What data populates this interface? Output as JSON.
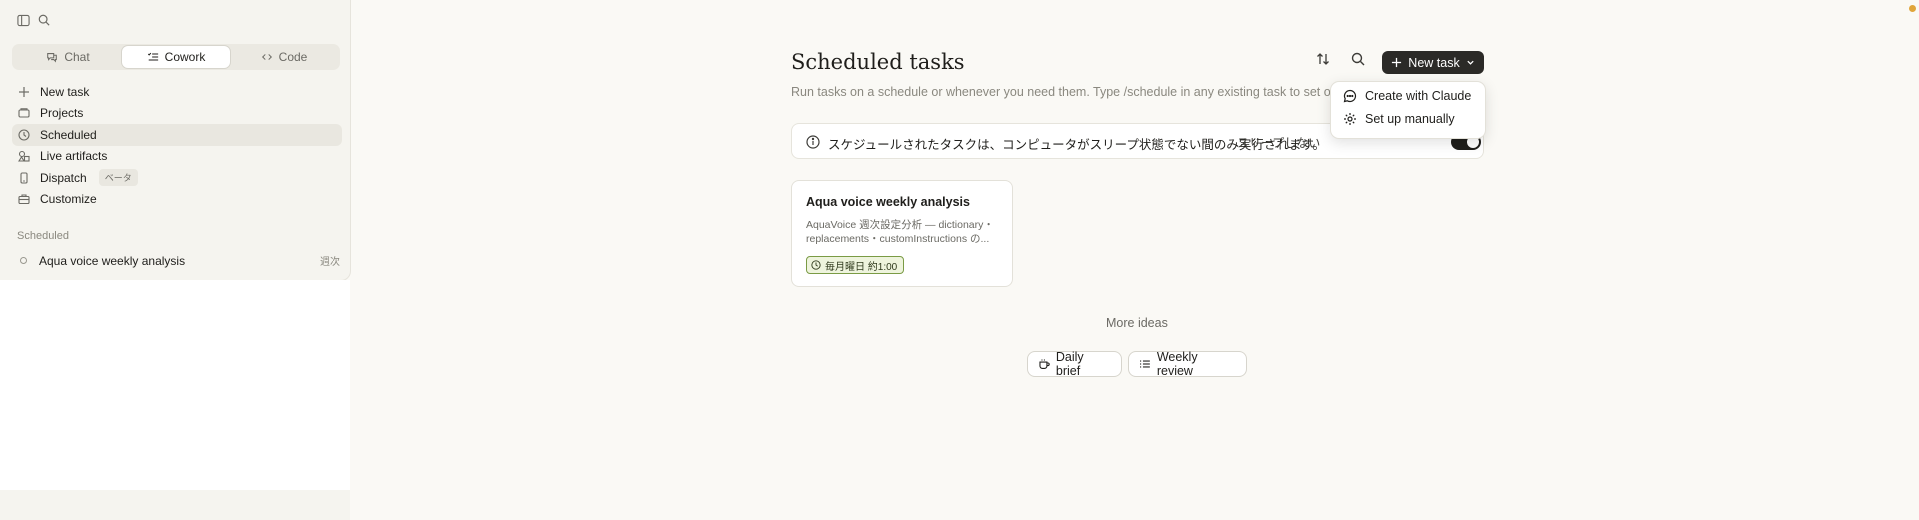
{
  "sidebar": {
    "modes": [
      {
        "label": "Chat"
      },
      {
        "label": "Cowork"
      },
      {
        "label": "Code"
      }
    ],
    "nav": [
      {
        "label": "New task"
      },
      {
        "label": "Projects"
      },
      {
        "label": "Scheduled"
      },
      {
        "label": "Live artifacts"
      },
      {
        "label": "Dispatch",
        "badge": "ベータ"
      },
      {
        "label": "Customize"
      }
    ],
    "section_label": "Scheduled",
    "scheduled_items": [
      {
        "label": "Aqua voice weekly analysis",
        "tag": "週次"
      }
    ]
  },
  "main": {
    "title": "Scheduled tasks",
    "subtitle": "Run tasks on a schedule or whenever you need them. Type /schedule in any existing task to set one up.",
    "new_task_label": "New task",
    "banner": {
      "text": "スケジュールされたタスクは、コンピュータがスリープ状態でない間のみ実行されます。",
      "right_label": "スリープしない",
      "toggle_on": true
    },
    "task_card": {
      "title": "Aqua voice weekly analysis",
      "desc_line1": "AquaVoice 週次設定分析 — dictionary・",
      "desc_line2": "replacements・customInstructions の...",
      "schedule": "毎月曜日 約1:00"
    },
    "more_ideas": "More ideas",
    "ideas": [
      {
        "label": "Daily brief"
      },
      {
        "label": "Weekly review"
      }
    ]
  },
  "dropdown": {
    "items": [
      {
        "label": "Create with Claude"
      },
      {
        "label": "Set up manually"
      }
    ]
  },
  "colors": {
    "accent_dark": "#2b2a27",
    "pill_border": "#7a9b45",
    "pill_bg": "#eef4dd",
    "status_dot": "#e0a53a"
  }
}
